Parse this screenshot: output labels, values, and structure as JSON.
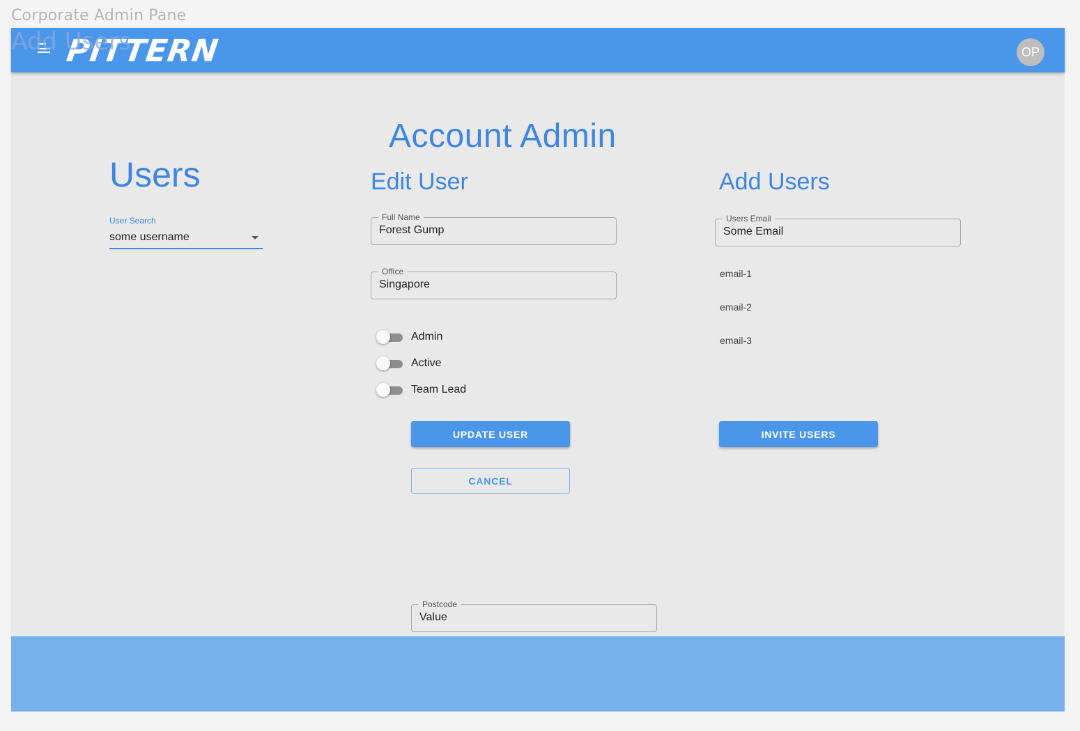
{
  "frame": {
    "title": "Corporate Admin Pane",
    "subtitle": "Add Users"
  },
  "appbar": {
    "logo_text": "PITTERN",
    "avatar_initials": "OP",
    "menu_icon": "hamburger-menu-icon"
  },
  "page": {
    "title": "Account Admin"
  },
  "users": {
    "title": "Users",
    "search_label": "User Search",
    "search_value": "some username"
  },
  "edit_user": {
    "title": "Edit User",
    "full_name_label": "Full Name",
    "full_name_value": "Forest Gump",
    "office_label": "Office",
    "office_value": "Singapore",
    "toggles": [
      {
        "label": "Admin",
        "on": false
      },
      {
        "label": "Active",
        "on": false
      },
      {
        "label": "Team Lead",
        "on": false
      }
    ],
    "update_label": "UPDATE USER",
    "cancel_label": "CANCEL",
    "postcode_label": "Postcode",
    "postcode_value": "Value"
  },
  "add_users": {
    "title": "Add Users",
    "email_label": "Users Email",
    "email_value": "Some Email",
    "emails": [
      "email-1",
      "email-2",
      "email-3"
    ],
    "invite_label": "INVITE USERS"
  },
  "colors": {
    "primary": "#4a96eb",
    "footer": "#78b0ee",
    "heading": "#3f86df"
  }
}
